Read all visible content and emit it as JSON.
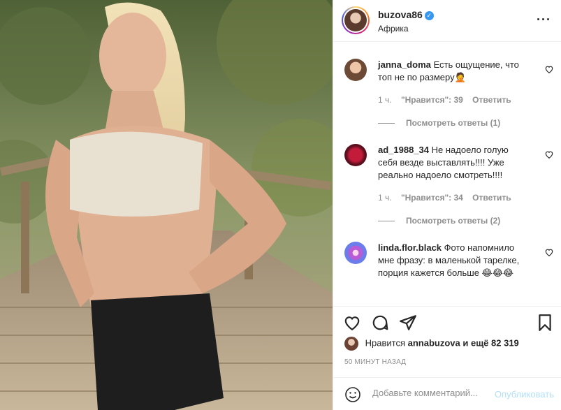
{
  "post": {
    "username": "buzova86",
    "verified_icon": "verified-badge-icon",
    "location": "Африка",
    "more_icon": "more-options-icon"
  },
  "comments": [
    {
      "user": "janna_doma",
      "text": "Есть ощущение, что топ не по размеру🤦",
      "time": "1 ч.",
      "likes": "\"Нравится\": 39",
      "reply": "Ответить",
      "view_replies": "Посмотреть ответы (1)"
    },
    {
      "user": "ad_1988_34",
      "text": "Не надоело голую себя везде выставлять!!!! Уже реально надоело смотреть!!!!",
      "time": "1 ч.",
      "likes": "\"Нравится\": 34",
      "reply": "Ответить",
      "view_replies": "Посмотреть ответы (2)"
    },
    {
      "user": "linda.flor.black",
      "text": "Фото напомнило мне фразу: в маленькой тарелке, порция кажется больше 😂😂😂"
    }
  ],
  "likes_line": {
    "prefix": "Нравится",
    "user": "annabuzova",
    "suffix": "и ещё 82 319"
  },
  "timestamp": "50 МИНУТ НАЗАД",
  "add_comment": {
    "placeholder": "Добавьте комментарий...",
    "publish": "Опубликовать"
  },
  "colors": {
    "link_disabled": "#b2dffc",
    "verified": "#3897f0",
    "muted": "#8e8e8e"
  }
}
